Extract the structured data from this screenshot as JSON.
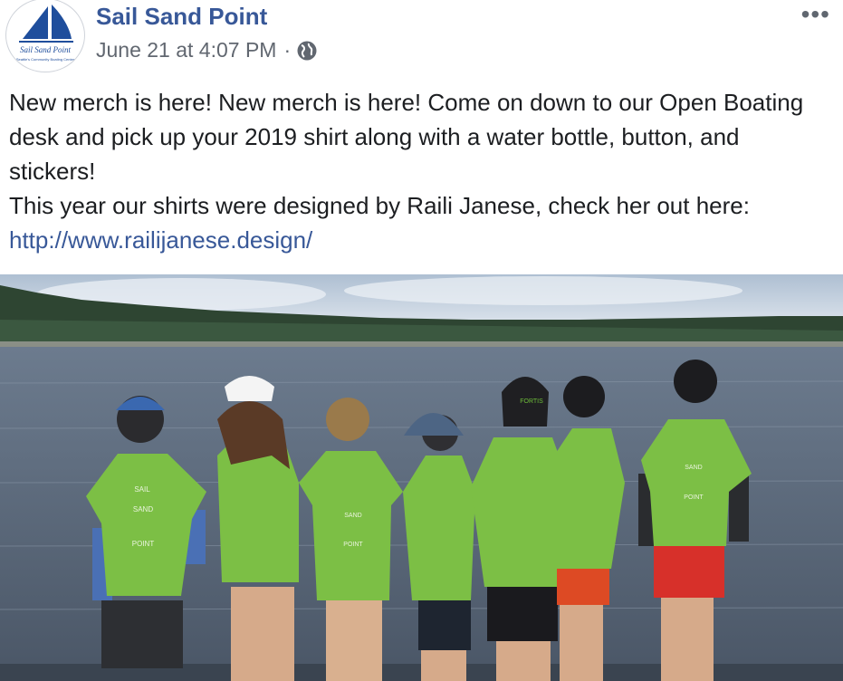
{
  "post": {
    "page_name": "Sail Sand Point",
    "timestamp": "June 21 at 4:07 PM",
    "separator": "·",
    "privacy_icon": "globe-icon",
    "more_icon": "more-options-icon",
    "more_label": "•••",
    "avatar": {
      "logo_text": "Sail Sand Point",
      "logo_subtext": "Seattle's Community Boating Center"
    },
    "text_line_1": "New merch is here! New merch is here! Come on down to our Open Boating desk and pick up your 2019 shirt along with a water bottle, button, and stickers!",
    "text_line_2_prefix": "This year our shirts were designed by Raili Janese, check her out here: ",
    "link_text": "http://www.railijanese.design/",
    "photo": {
      "shirt_text_words": [
        "SAIL",
        "SAND",
        "POINT"
      ],
      "hat_text": "FORTIS"
    }
  },
  "colors": {
    "link": "#385898",
    "text": "#1c1e21",
    "meta": "#616770",
    "shirt": "#7cbf45",
    "water": "#5b6a7c",
    "sky": "#c7d3e0"
  }
}
